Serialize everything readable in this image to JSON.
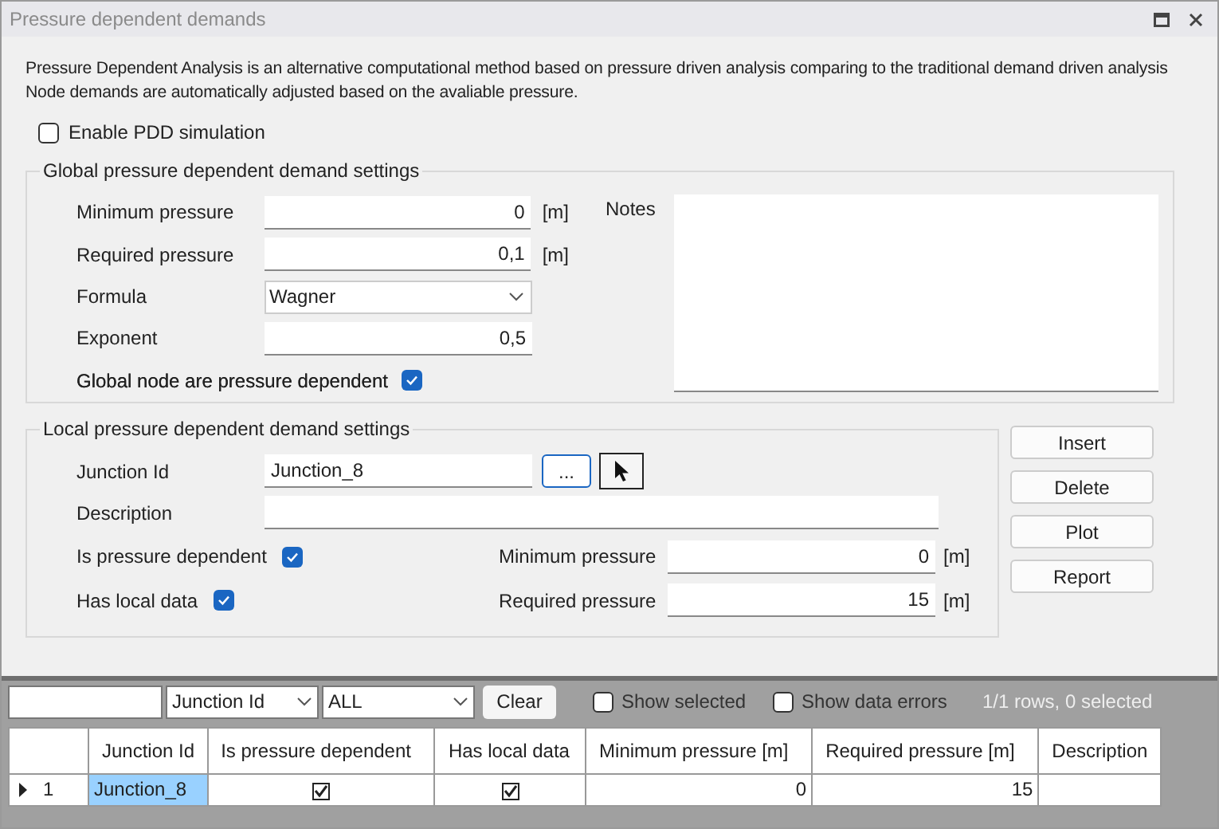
{
  "window": {
    "title": "Pressure dependent demands"
  },
  "description": [
    "Pressure Dependent Analysis is an alternative computational method based on pressure driven analysis comparing to the traditional demand driven analysis",
    "Node demands are automatically adjusted based on the avaliable pressure."
  ],
  "enable_pdd": {
    "label": "Enable PDD simulation",
    "checked": false
  },
  "global": {
    "title": "Global pressure dependent demand settings",
    "fields": [
      {
        "kind": "number",
        "label": "Minimum pressure",
        "value": "0",
        "unit": "[m]"
      },
      {
        "kind": "number",
        "label": "Required pressure",
        "value": "0,1",
        "unit": "[m]"
      },
      {
        "kind": "select",
        "label": "Formula",
        "value": "Wagner"
      },
      {
        "kind": "number",
        "label": "Exponent",
        "value": "0,5"
      },
      {
        "kind": "checkbox",
        "label": "Global node are pressure dependent",
        "checked": true
      }
    ],
    "notes": {
      "label": "Notes"
    }
  },
  "local": {
    "title": "Local pressure dependent demand settings",
    "junction_id": {
      "label": "Junction Id",
      "value": "Junction_8",
      "browse": "..."
    },
    "description": {
      "label": "Description"
    },
    "is_pressure_dependent": {
      "label": "Is pressure dependent",
      "checked": true
    },
    "has_local_data": {
      "label": "Has local data",
      "checked": true
    },
    "minimum_pressure": {
      "label": "Minimum pressure",
      "value": "0",
      "unit": "[m]"
    },
    "required_pressure": {
      "label": "Required pressure",
      "value": "15",
      "unit": "[m]"
    }
  },
  "buttons": [
    "Insert",
    "Delete",
    "Plot",
    "Report"
  ],
  "toolbar": {
    "column_select": "Junction Id",
    "filter_select": "ALL",
    "clear": "Clear",
    "show_selected": {
      "label": "Show selected",
      "checked": false
    },
    "show_errors": {
      "label": "Show data errors",
      "checked": false
    },
    "status": "1/1 rows, 0 selected"
  },
  "table": {
    "columns": [
      "Junction Id",
      "Is pressure dependent",
      "Has local data",
      "Minimum pressure [m]",
      "Required pressure [m]",
      "Description"
    ],
    "rows": [
      {
        "number": "1",
        "current": true,
        "cells": [
          {
            "kind": "text",
            "value": "Junction_8",
            "selected": true
          },
          {
            "kind": "check",
            "checked": true
          },
          {
            "kind": "check",
            "checked": true
          },
          {
            "kind": "number",
            "value": "0"
          },
          {
            "kind": "number",
            "value": "15"
          },
          {
            "kind": "text"
          }
        ]
      }
    ]
  }
}
